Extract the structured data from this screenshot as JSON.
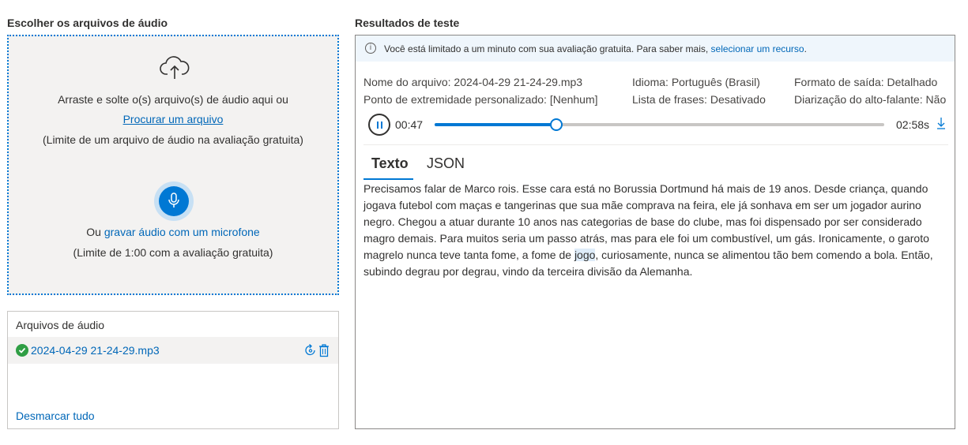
{
  "left": {
    "title": "Escolher os arquivos de áudio",
    "drop_text": "Arraste e solte o(s) arquivo(s) de áudio aqui ou",
    "browse_link": "Procurar um arquivo",
    "file_limit": "(Limite de um arquivo de áudio na avaliação gratuita)",
    "mic_prefix": "Ou",
    "mic_link": "gravar áudio com um microfone",
    "mic_limit": "(Limite de 1:00 com a avaliação gratuita)"
  },
  "files": {
    "title": "Arquivos de áudio",
    "items": [
      {
        "name": "2024-04-29 21-24-29.mp3",
        "status": "success"
      }
    ],
    "deselect_all": "Desmarcar tudo"
  },
  "results": {
    "title": "Resultados de teste",
    "info_text": "Você está limitado a um minuto com sua avaliação gratuita. Para saber mais,",
    "info_link": "selecionar um recurso",
    "info_end": ".",
    "meta": {
      "file_label": "Nome do arquivo:",
      "file_value": "2024-04-29 21-24-29.mp3",
      "endpoint_label": "Ponto de extremidade personalizado:",
      "endpoint_value": "[Nenhum]",
      "language_label": "Idioma:",
      "language_value": "Português (Brasil)",
      "phrase_label": "Lista de frases:",
      "phrase_value": "Desativado",
      "format_label": "Formato de saída:",
      "format_value": "Detalhado",
      "diarization_label": "Diarização do alto-falante:",
      "diarization_value": "Não"
    },
    "player": {
      "current_time": "00:47",
      "total_time": "02:58s",
      "progress": 0.27
    },
    "tabs": [
      "Texto",
      "JSON"
    ],
    "transcript_before": "Precisamos falar de Marco rois. Esse cara está no Borussia Dortmund há mais de 19 anos. Desde criança, quando jogava futebol com maças e tangerinas que sua mãe comprava na feira, ele já sonhava em ser um jogador aurino negro. Chegou a atuar durante 10 anos nas categorias de base do clube, mas foi dispensado por ser considerado magro demais. Para muitos seria um passo atrás, mas para ele foi um combustível, um gás. Ironicamente, o garoto magrelo nunca teve tanta fome, a fome de ",
    "transcript_highlight": "jogo",
    "transcript_after": ", curiosamente, nunca se alimentou tão bem comendo a bola. Então, subindo degrau por degrau, vindo da terceira divisão da Alemanha."
  },
  "colors": {
    "accent": "#0078d4",
    "link": "#0067b8",
    "success": "#2f9e44"
  }
}
